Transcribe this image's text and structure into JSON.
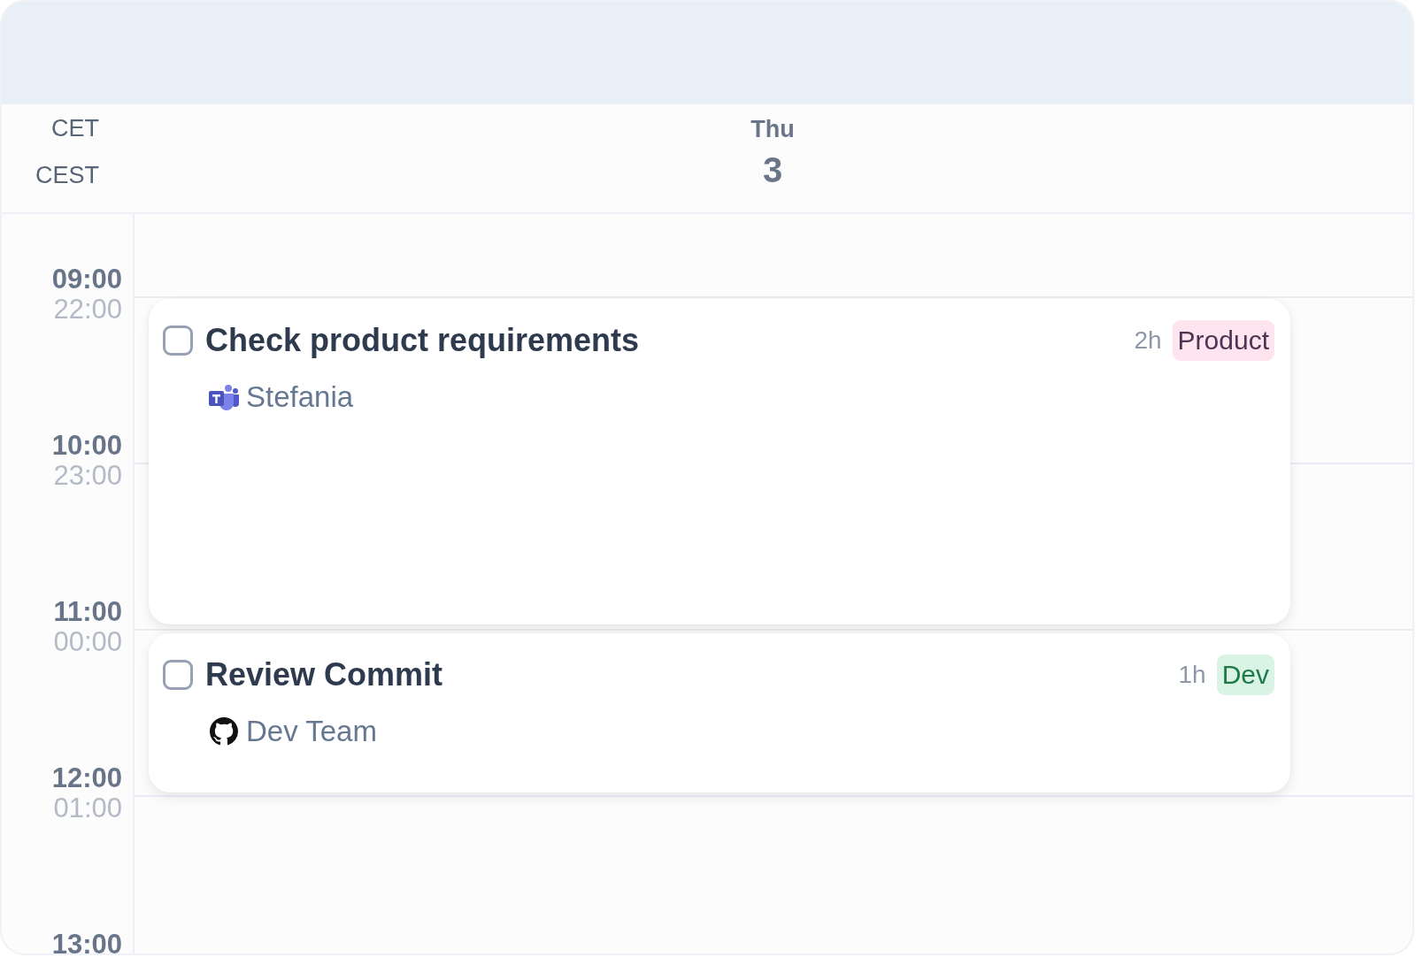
{
  "timezones": [
    "CET",
    "CEST"
  ],
  "day": {
    "weekday": "Thu",
    "date": "3"
  },
  "hours": [
    {
      "primary": "09:00",
      "secondary": "22:00"
    },
    {
      "primary": "10:00",
      "secondary": "23:00"
    },
    {
      "primary": "11:00",
      "secondary": "00:00"
    },
    {
      "primary": "12:00",
      "secondary": "01:00"
    },
    {
      "primary": "13:00"
    }
  ],
  "events": [
    {
      "title": "Check product requirements",
      "checked": false,
      "duration": "2h",
      "tag": {
        "label": "Product",
        "color": "#fde4ef"
      },
      "source": {
        "kind": "teams",
        "name": "Stefania"
      }
    },
    {
      "title": "Review Commit",
      "checked": false,
      "duration": "1h",
      "tag": {
        "label": "Dev",
        "color": "#d9f3e4"
      },
      "source": {
        "kind": "github",
        "name": "Dev Team"
      }
    }
  ]
}
